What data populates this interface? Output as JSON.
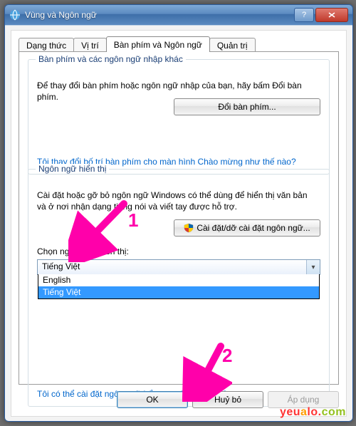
{
  "window": {
    "title": "Vùng và Ngôn ngữ"
  },
  "tabs": {
    "t0": "Dạng thức",
    "t1": "Vị trí",
    "t2": "Bàn phím và Ngôn ngữ",
    "t3": "Quản trị"
  },
  "group1": {
    "legend": "Bàn phím và các ngôn ngữ nhập khác",
    "desc": "Để thay đổi bàn phím hoặc ngôn ngữ nhập của bạn, hãy bấm Đổi bàn phím.",
    "btn": "Đổi bàn phím...",
    "link": "Tôi thay đổi bố trí bàn phím cho màn hình Chào mừng như thế nào?"
  },
  "group2": {
    "legend": "Ngôn ngữ hiển thị",
    "desc": "Cài đặt hoặc gỡ bỏ ngôn ngữ Windows có thể dùng để hiển thị văn bản và ở nơi nhận dạng tiếng nói và viết tay được hỗ trợ.",
    "installBtn": "Cài đặt/dỡ cài đặt ngôn ngữ...",
    "selectLabel": "Chọn ngôn ngữ hiển thị:",
    "selected": "Tiếng Việt",
    "options": {
      "o0": "English",
      "o1": "Tiếng Việt"
    },
    "link": "Tôi có thể cài đặt ngôn ngữ bổ sung như thế nào?"
  },
  "buttons": {
    "ok": "OK",
    "cancel": "Huỷ bỏ",
    "apply": "Áp dụng"
  },
  "annotations": {
    "n1": "1",
    "n2": "2"
  },
  "watermark": {
    "p1": "yeu",
    "p2": "a",
    "p3": "lo.",
    "p4": "com"
  }
}
